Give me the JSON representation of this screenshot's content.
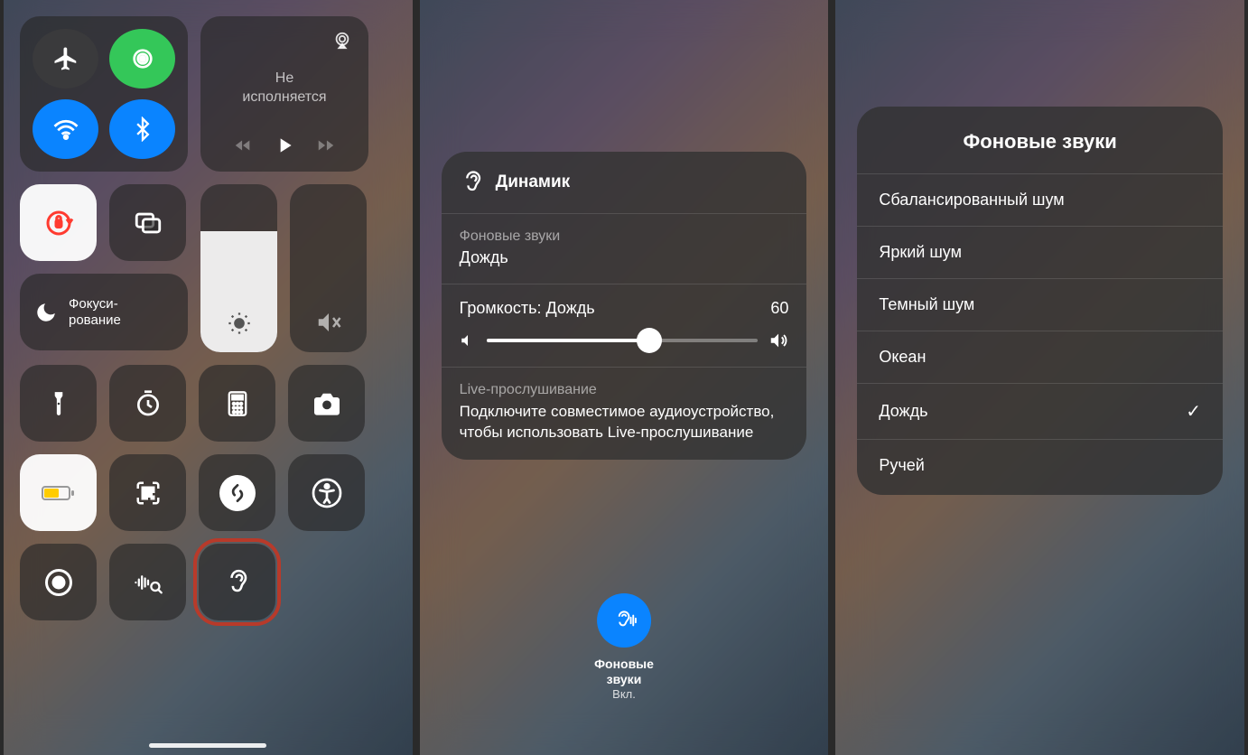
{
  "panel1": {
    "music": {
      "status": "Не\nисполняется"
    },
    "focus": {
      "label": "Фокуси-\nрование"
    }
  },
  "panel2": {
    "header": "Динамик",
    "bg_sounds_label": "Фоновые звуки",
    "bg_sounds_value": "Дождь",
    "volume_label": "Громкость: Дождь",
    "volume_value": "60",
    "live_label": "Live-прослушивание",
    "live_body": "Подключите совместимое аудиоустройство, чтобы использовать Live-прослушивание",
    "button_label": "Фоновые\nзвуки",
    "button_state": "Вкл."
  },
  "panel3": {
    "title": "Фоновые звуки",
    "items": [
      {
        "label": "Сбалансированный шум",
        "checked": false
      },
      {
        "label": "Яркий шум",
        "checked": false
      },
      {
        "label": "Темный шум",
        "checked": false
      },
      {
        "label": "Океан",
        "checked": false
      },
      {
        "label": "Дождь",
        "checked": true
      },
      {
        "label": "Ручей",
        "checked": false
      }
    ]
  }
}
